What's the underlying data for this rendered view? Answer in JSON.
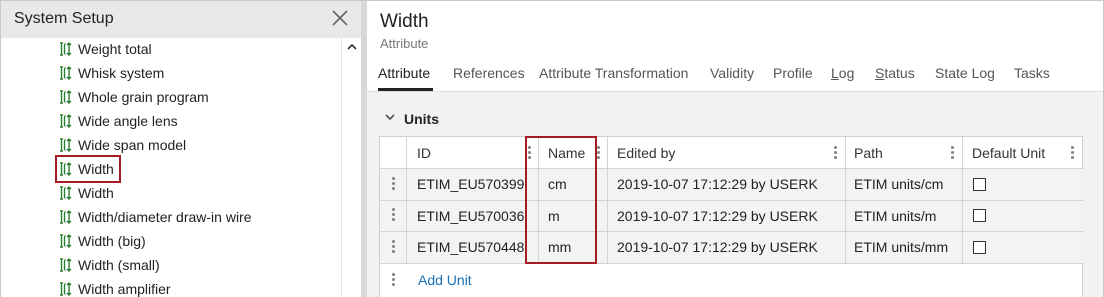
{
  "left_panel": {
    "title": "System Setup",
    "items": [
      {
        "label": "Weight total"
      },
      {
        "label": "Whisk system"
      },
      {
        "label": "Whole grain program"
      },
      {
        "label": "Wide angle lens"
      },
      {
        "label": "Wide span model"
      },
      {
        "label": "Width",
        "selected": true
      },
      {
        "label": "Width"
      },
      {
        "label": "Width/diameter draw-in wire"
      },
      {
        "label": "Width (big)"
      },
      {
        "label": "Width (small)"
      },
      {
        "label": "Width amplifier"
      }
    ],
    "item_icon": "attribute-icon",
    "highlight_color": "#a61c24"
  },
  "header": {
    "title": "Width",
    "subtitle": "Attribute"
  },
  "tabs": [
    {
      "label": "Attribute",
      "active": true
    },
    {
      "label": "References"
    },
    {
      "label": "Attribute Transformation"
    },
    {
      "label": "Validity"
    },
    {
      "label": "Profile"
    },
    {
      "label": "Log"
    },
    {
      "label": "Status"
    },
    {
      "label": "State Log"
    },
    {
      "label": "Tasks"
    }
  ],
  "section": {
    "title": "Units",
    "columns": [
      "ID",
      "Name",
      "Edited by",
      "Path",
      "Default Unit"
    ],
    "rows": [
      {
        "id": "ETIM_EU570399",
        "name": "cm",
        "edited_by": "2019-10-07 17:12:29 by USERK",
        "path": "ETIM units/cm",
        "default": false
      },
      {
        "id": "ETIM_EU570036",
        "name": "m",
        "edited_by": "2019-10-07 17:12:29 by USERK",
        "path": "ETIM units/m",
        "default": false
      },
      {
        "id": "ETIM_EU570448",
        "name": "mm",
        "edited_by": "2019-10-07 17:12:29 by USERK",
        "path": "ETIM units/mm",
        "default": false
      }
    ],
    "add_label": "Add Unit"
  },
  "colors": {
    "link": "#1a73b8",
    "highlight": "#a61c24",
    "header_bg": "#e8e8e8",
    "section_bg": "#f2f2f2"
  }
}
